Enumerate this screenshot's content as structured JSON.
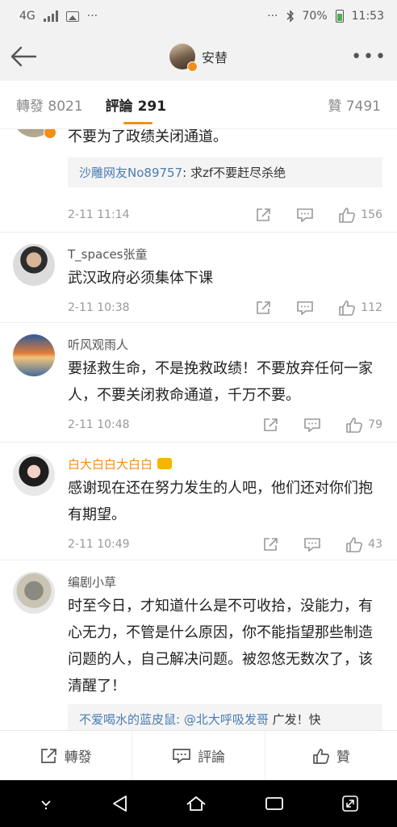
{
  "status_bar": {
    "network": "4G",
    "more": "···",
    "more_right": "···",
    "battery": "70%",
    "time": "11:53"
  },
  "nav": {
    "title": "安替",
    "more": "•••"
  },
  "tabs": {
    "repost_label": "轉發",
    "repost_count": "8021",
    "comments_label": "評論",
    "comments_count": "291",
    "likes_label": "贊",
    "likes_count": "7491"
  },
  "comments": [
    {
      "text": "不要为了政绩关闭通道。",
      "reply_user": "沙雕网友No89757",
      "reply_text": ": 求zf不要赶尽杀绝",
      "time": "2-11 11:14",
      "likes": "156"
    },
    {
      "user": "T_spaces张童",
      "text": "武汉政府必须集体下课",
      "time": "2-11 10:38",
      "likes": "112"
    },
    {
      "user": "听风观雨人",
      "text": "要拯救生命，不是挽救政绩！不要放弃任何一家人，不要关闭救命通道，千万不要。",
      "time": "2-11 10:48",
      "likes": "79"
    },
    {
      "user": "白大白白大白白",
      "text": "感谢现在还在努力发生的人吧，他们还对你们抱有期望。",
      "time": "2-11 10:49",
      "likes": "43"
    },
    {
      "user": "编剧小草",
      "text": "时至今日，才知道什么是不可收拾，没能力，有心无力，不管是什么原因，你不能指望那些制造问题的人，自己解决问题。被忽悠无数次了，该清醒了！",
      "reply_user": "不爱喝水的蓝皮鼠",
      "reply_mention": ": @北大呼吸发哥",
      "reply_text": " 广发！快"
    }
  ],
  "bottom_bar": {
    "repost": "轉發",
    "comment": "評論",
    "like": "贊"
  },
  "colors": {
    "accent": "#f28e1a",
    "link": "#4a7cb3"
  }
}
